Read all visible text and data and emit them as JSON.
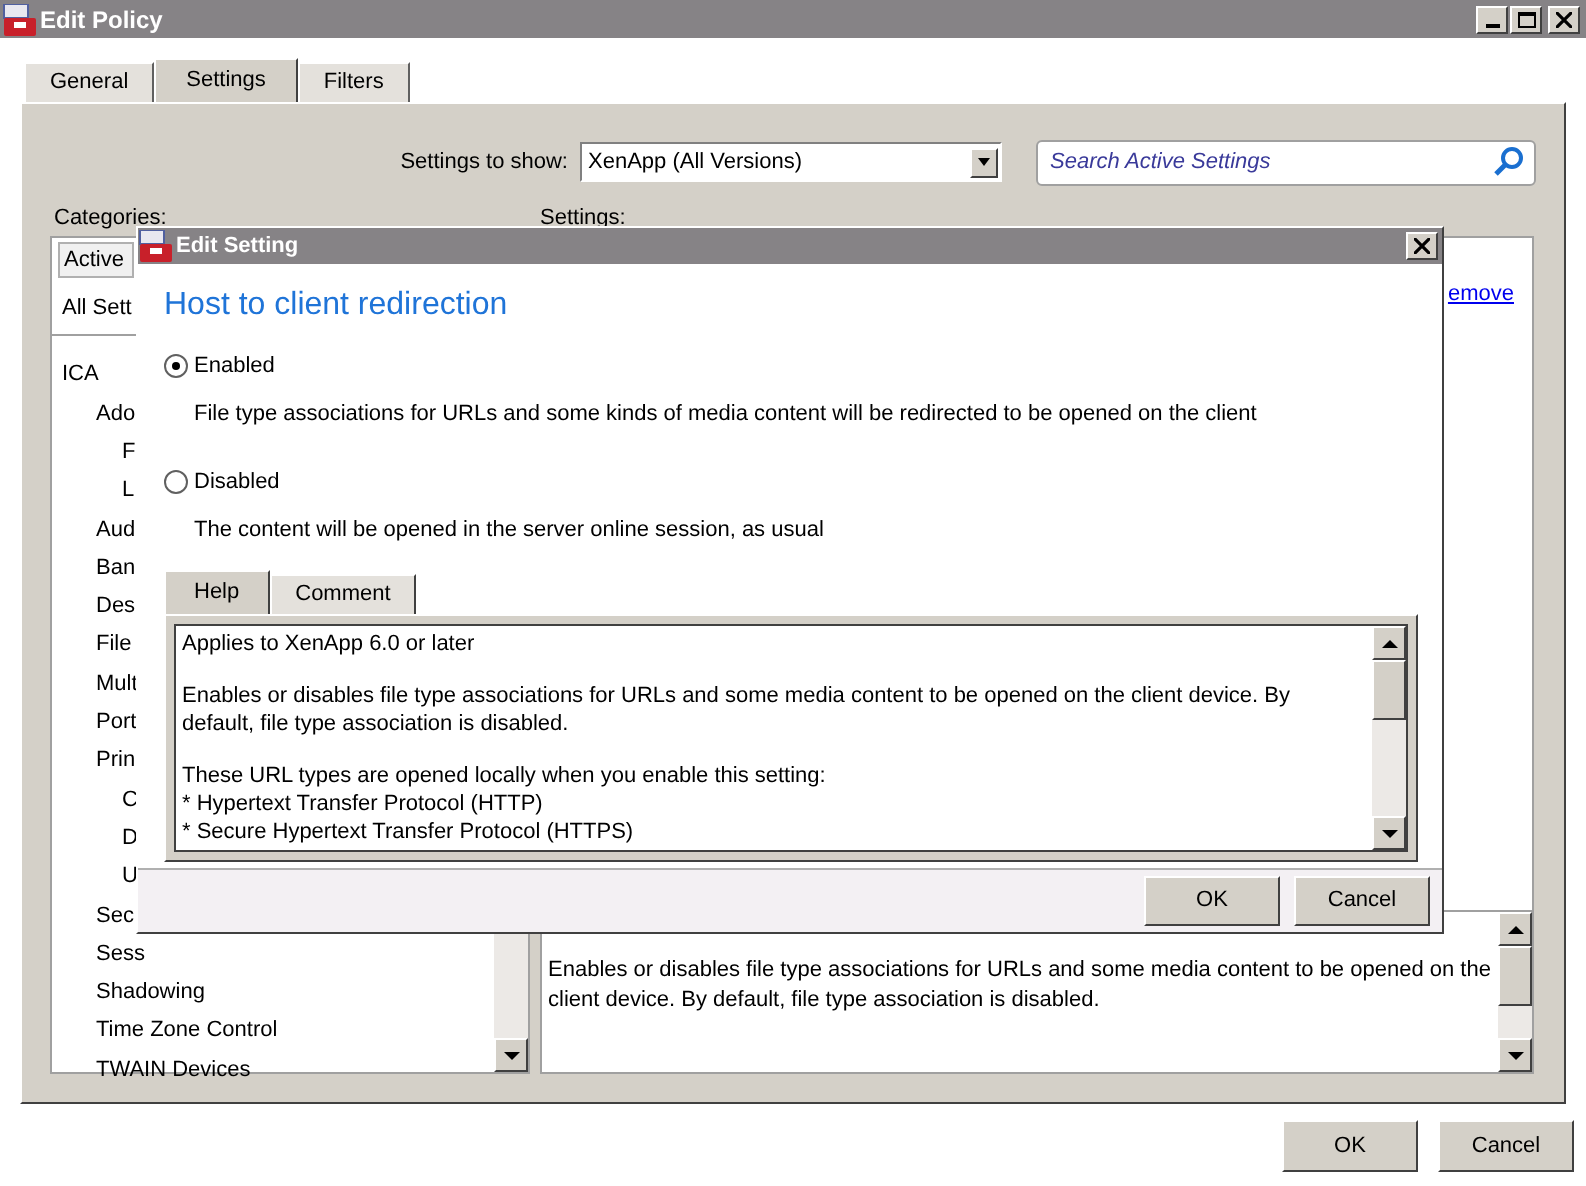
{
  "window": {
    "title": "Edit Policy"
  },
  "tabs": [
    {
      "label": "General",
      "selected": false
    },
    {
      "label": "Settings",
      "selected": true
    },
    {
      "label": "Filters",
      "selected": false
    }
  ],
  "settings_to_show": {
    "label": "Settings to show:",
    "value": "XenApp (All Versions)"
  },
  "search": {
    "placeholder": "Search Active Settings"
  },
  "categories": {
    "label": "Categories:",
    "views": [
      {
        "label": "Active",
        "selected": true
      },
      {
        "label": "All Sett",
        "selected": false
      }
    ],
    "tree": [
      {
        "label": "ICA",
        "children": [
          {
            "label": "Ado",
            "children": [
              {
                "label": "F"
              },
              {
                "label": "L"
              }
            ]
          },
          {
            "label": "Aud"
          },
          {
            "label": "Ban"
          },
          {
            "label": "Des"
          },
          {
            "label": "File"
          },
          {
            "label": "Mult"
          },
          {
            "label": "Port"
          },
          {
            "label": "Prin",
            "children": [
              {
                "label": "C"
              },
              {
                "label": "D"
              },
              {
                "label": "U"
              }
            ]
          },
          {
            "label": "Sec"
          },
          {
            "label": "Sess"
          },
          {
            "label": "Shadowing"
          },
          {
            "label": "Time Zone Control"
          },
          {
            "label": "TWAIN Devices"
          }
        ]
      }
    ]
  },
  "settings": {
    "label": "Settings:",
    "link": "emove",
    "description": "Enables or disables file type associations for URLs and some media content to be opened on the client device. By default, file type association is disabled."
  },
  "buttons": [
    "OK",
    "Cancel"
  ],
  "dialog": {
    "title": "Edit Setting",
    "heading": "Host to client redirection",
    "options": [
      {
        "label": "Enabled",
        "selected": true,
        "description": "File type associations for URLs and some kinds of media content will be redirected to be opened on the client"
      },
      {
        "label": "Disabled",
        "selected": false,
        "description": "The content will be opened in the server online session, as usual"
      }
    ],
    "tabs": [
      {
        "label": "Help",
        "selected": true
      },
      {
        "label": "Comment",
        "selected": false
      }
    ],
    "help_paragraphs": [
      [
        "Applies to XenApp 6.0 or later"
      ],
      [
        "Enables or disables file type associations for URLs and some media content to be opened on the client device. By default, file type association is disabled."
      ],
      [
        "These URL types are opened locally when you enable this setting:",
        "* Hypertext Transfer Protocol (HTTP)",
        "* Secure Hypertext Transfer Protocol (HTTPS)"
      ]
    ],
    "buttons": [
      "OK",
      "Cancel"
    ]
  }
}
